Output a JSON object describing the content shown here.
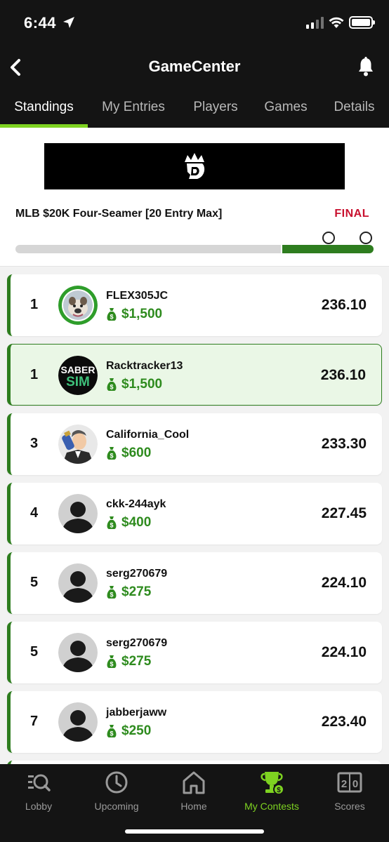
{
  "status_bar": {
    "time": "6:44"
  },
  "header": {
    "title": "GameCenter"
  },
  "tabs": [
    {
      "label": "Standings",
      "active": true
    },
    {
      "label": "My Entries",
      "active": false
    },
    {
      "label": "Players",
      "active": false
    },
    {
      "label": "Games",
      "active": false
    },
    {
      "label": "Details",
      "active": false
    }
  ],
  "contest": {
    "name": "MLB $20K Four-Seamer [20 Entry Max]",
    "status": "FINAL",
    "progress": 0.25
  },
  "standings": [
    {
      "rank": "1",
      "username": "FLEX305JC",
      "prize": "$1,500",
      "score": "236.10",
      "highlight": false,
      "avatar": "bulldog"
    },
    {
      "rank": "1",
      "username": "Racktracker13",
      "prize": "$1,500",
      "score": "236.10",
      "highlight": true,
      "avatar": "sabersim"
    },
    {
      "rank": "3",
      "username": "California_Cool",
      "prize": "$600",
      "score": "233.30",
      "highlight": false,
      "avatar": "cartoon"
    },
    {
      "rank": "4",
      "username": "ckk-244ayk",
      "prize": "$400",
      "score": "227.45",
      "highlight": false,
      "avatar": "default"
    },
    {
      "rank": "5",
      "username": "serg270679",
      "prize": "$275",
      "score": "224.10",
      "highlight": false,
      "avatar": "default"
    },
    {
      "rank": "5",
      "username": "serg270679",
      "prize": "$275",
      "score": "224.10",
      "highlight": false,
      "avatar": "default"
    },
    {
      "rank": "7",
      "username": "jabberjaww",
      "prize": "$250",
      "score": "223.40",
      "highlight": false,
      "avatar": "default"
    }
  ],
  "avatar_text": {
    "sabersim_top": "SABER",
    "sabersim_bottom": "SIM"
  },
  "bottom_nav": [
    {
      "label": "Lobby",
      "icon": "lobby-search-icon",
      "active": false
    },
    {
      "label": "Upcoming",
      "icon": "clock-icon",
      "active": false
    },
    {
      "label": "Home",
      "icon": "home-icon",
      "active": false
    },
    {
      "label": "My Contests",
      "icon": "trophy-icon",
      "active": true
    },
    {
      "label": "Scores",
      "icon": "scoreboard-icon",
      "active": false
    }
  ],
  "colors": {
    "accent_green": "#7ed321",
    "dark_green": "#2e7d1f",
    "prize_green": "#2e8b1e",
    "final_red": "#c8102e",
    "background_dark": "#141414"
  }
}
